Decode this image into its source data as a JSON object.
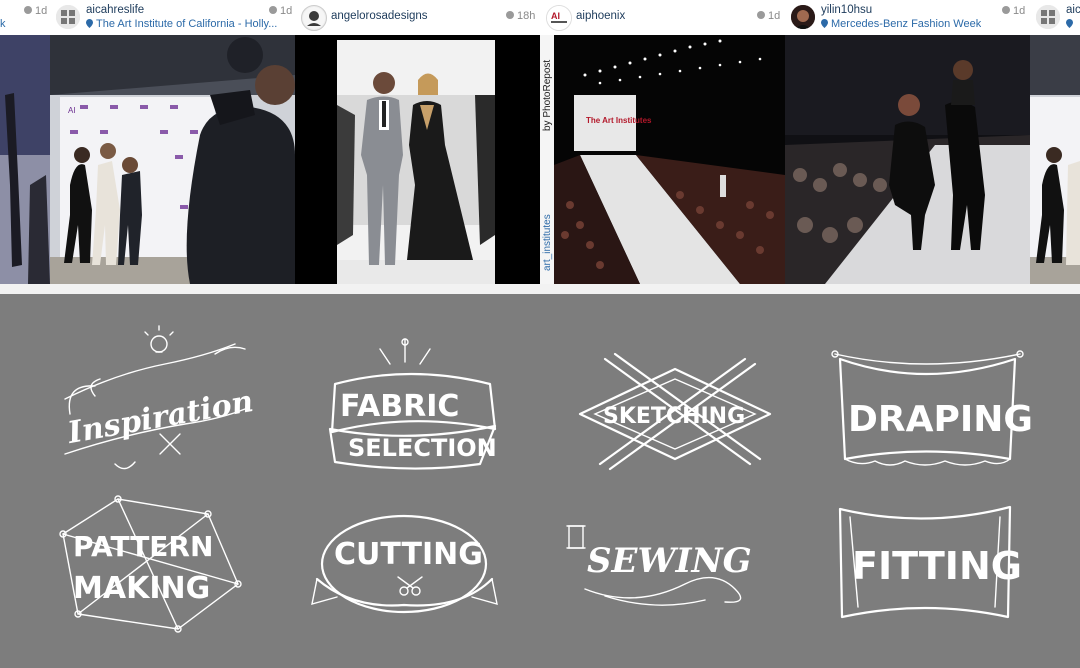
{
  "feed": {
    "posts": [
      {
        "username": "",
        "location": "",
        "time": "1d"
      },
      {
        "username": "aicahreslife",
        "location": "The Art Institute of California - Holly...",
        "time": "1d"
      },
      {
        "username": "angelorosadesigns",
        "location": "",
        "time": "18h"
      },
      {
        "username": "aiphoenix",
        "location": "",
        "time": "1d"
      },
      {
        "username": "yilin10hsu",
        "location": "Mercedes-Benz Fashion Week",
        "time": "1d"
      },
      {
        "username": "aic",
        "location": "",
        "time": ""
      }
    ],
    "photo_repost_credit": "by PhotoRepost",
    "photo_repost_handle": "art_institutes",
    "backdrop_logo": "AI",
    "runway_sign": "The Art Institutes"
  },
  "badges": [
    {
      "id": "inspiration",
      "lines": [
        "Inspiration"
      ]
    },
    {
      "id": "fabric-selection",
      "lines": [
        "FABRIC",
        "SELECTION"
      ]
    },
    {
      "id": "sketching",
      "lines": [
        "SKETCHING"
      ]
    },
    {
      "id": "draping",
      "lines": [
        "DRAPING"
      ]
    },
    {
      "id": "pattern-making",
      "lines": [
        "PATTERN",
        "MAKING"
      ]
    },
    {
      "id": "cutting",
      "lines": [
        "CUTTING"
      ]
    },
    {
      "id": "sewing",
      "lines": [
        "SEWING"
      ]
    },
    {
      "id": "fitting",
      "lines": [
        "FITTING"
      ]
    }
  ],
  "colors": {
    "panel": "#7d7d7d",
    "link": "#2c6aa8",
    "username": "#1d3b5b",
    "time": "#8a8a8a"
  }
}
